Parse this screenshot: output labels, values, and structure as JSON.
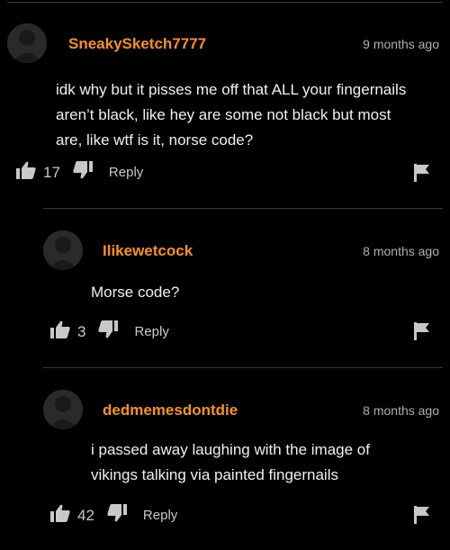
{
  "comments": [
    {
      "username": "SneakySketch7777",
      "time": "9 months ago",
      "text_lines": [
        "idk why but it pisses me off that ALL your fingernails",
        "aren’t black, like hey are some not black but most",
        "are, like wtf is it, norse code?"
      ],
      "likes": "17",
      "reply_label": "Reply"
    },
    {
      "username": "Ilikewetcock",
      "time": "8 months ago",
      "text_lines": [
        "Morse code?"
      ],
      "likes": "3",
      "reply_label": "Reply"
    },
    {
      "username": "dedmemesdontdie",
      "time": "8 months ago",
      "text_lines": [
        "i passed away laughing with the image of",
        "vikings talking via painted fingernails"
      ],
      "likes": "42",
      "reply_label": "Reply"
    }
  ],
  "icons": {
    "like": "thumbs-up-icon",
    "dislike": "thumbs-down-icon",
    "flag": "flag-icon",
    "avatar": "avatar-icon"
  },
  "colors": {
    "background": "#000000",
    "username": "#f7931e",
    "divider": "#3a3a3a"
  }
}
